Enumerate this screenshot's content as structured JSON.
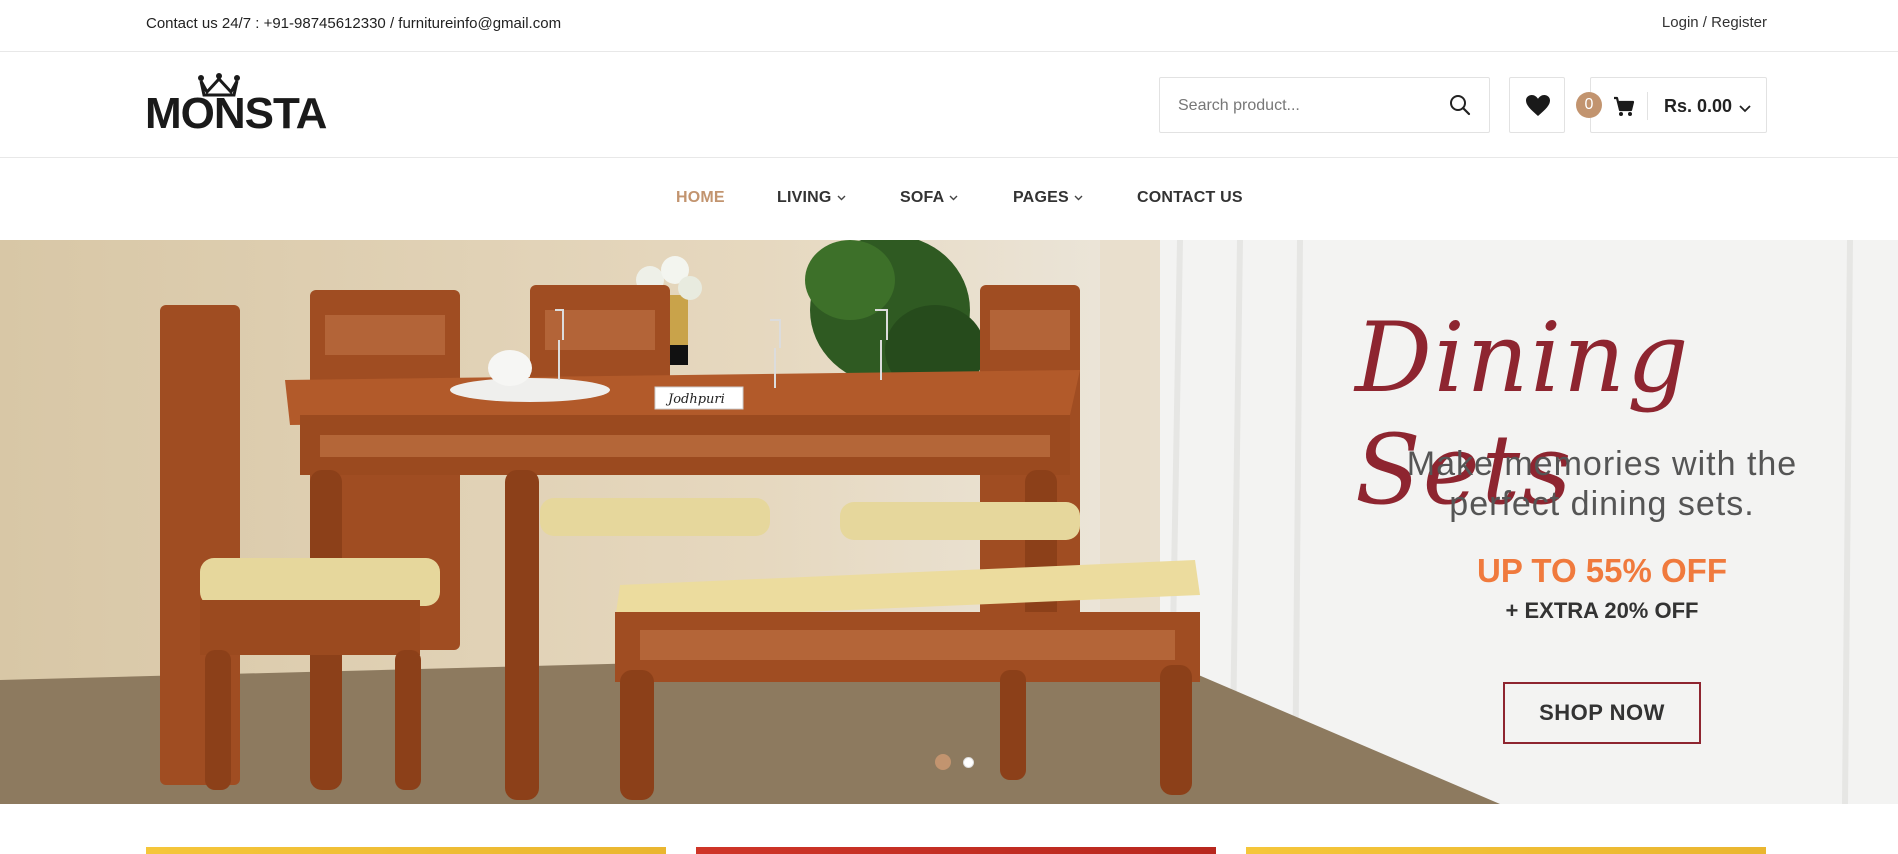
{
  "topbar": {
    "contact": "Contact us 24/7 : +91-98745612330 / furnitureinfo@gmail.com",
    "login": "Login",
    "separator": " / ",
    "register": "Register"
  },
  "header": {
    "logo_text": "MONSTA",
    "search_placeholder": "Search product...",
    "cart_count": "0",
    "cart_total": "Rs. 0.00"
  },
  "nav": {
    "items": [
      {
        "label": "HOME",
        "active": true
      },
      {
        "label": "LIVING",
        "dropdown": true
      },
      {
        "label": "SOFA",
        "dropdown": true
      },
      {
        "label": "PAGES",
        "dropdown": true
      },
      {
        "label": "CONTACT US"
      }
    ]
  },
  "hero": {
    "title": "Dining Sets",
    "subtitle_line1": "Make memories with the",
    "subtitle_line2": "perfect dining sets.",
    "offer": "UP TO 55% OFF",
    "extra": "+ EXTRA 20% OFF",
    "cta": "SHOP NOW",
    "brand_tag": "Jodhpuri",
    "slides": 2,
    "active_slide": 1
  },
  "colors": {
    "accent": "#c2946f",
    "title": "#8e2530",
    "offer": "#f07a3d"
  }
}
